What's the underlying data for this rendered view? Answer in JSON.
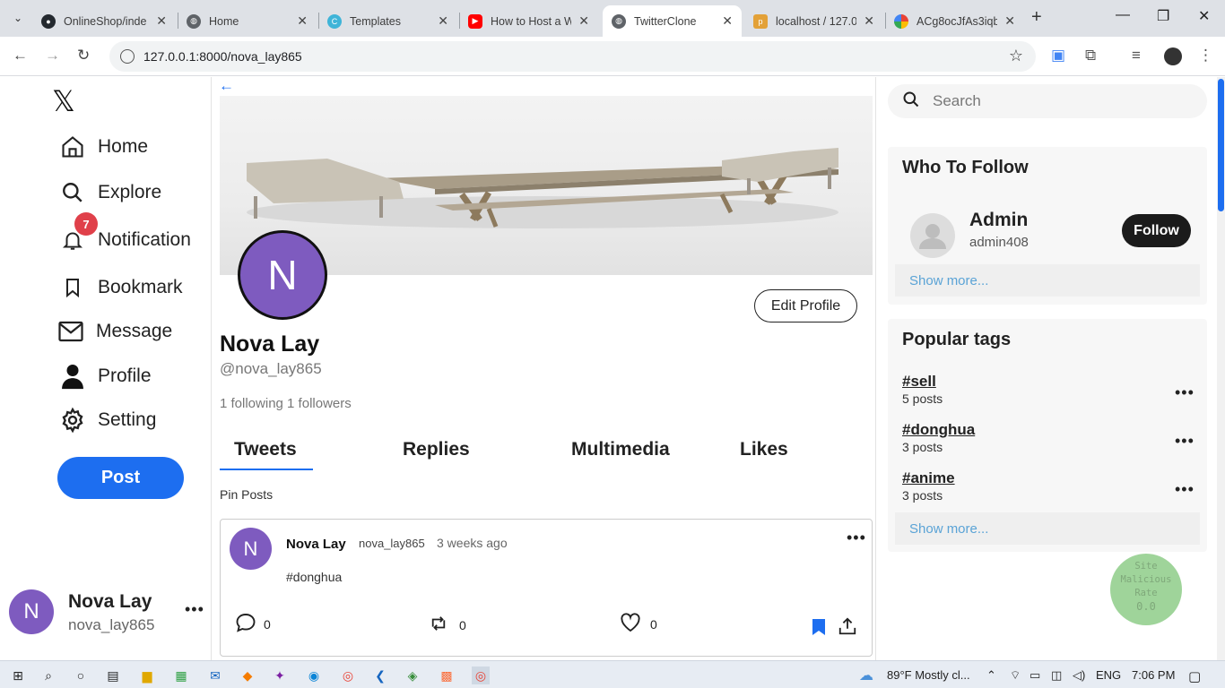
{
  "browser": {
    "tabs": [
      {
        "title": "OnlineShop/inde",
        "icon": "github-icon",
        "color": "#24292f"
      },
      {
        "title": "Home",
        "icon": "globe-icon",
        "color": "#5f6368"
      },
      {
        "title": "Templates",
        "icon": "canva-icon",
        "color": "#3fb4d8"
      },
      {
        "title": "How to Host a W",
        "icon": "youtube-icon",
        "color": "#ff0000"
      },
      {
        "title": "TwitterClone",
        "icon": "globe-icon",
        "color": "#5f6368"
      },
      {
        "title": "localhost / 127.0",
        "icon": "phpmyadmin-icon",
        "color": "#e3a138"
      },
      {
        "title": "ACg8ocJfAs3iqb",
        "icon": "google-photos-icon",
        "color": "#ea4335"
      }
    ],
    "url": "127.0.0.1:8000/nova_lay865"
  },
  "sidebar": {
    "logo": "𝕏",
    "items": [
      {
        "label": "Home",
        "icon": "home-icon"
      },
      {
        "label": "Explore",
        "icon": "search-icon"
      },
      {
        "label": "Notification",
        "icon": "bell-icon"
      },
      {
        "label": "Bookmark",
        "icon": "bookmark-icon"
      },
      {
        "label": "Message",
        "icon": "mail-icon"
      },
      {
        "label": "Profile",
        "icon": "user-icon"
      },
      {
        "label": "Setting",
        "icon": "gear-icon"
      }
    ],
    "notification_count": "7",
    "post_label": "Post",
    "account": {
      "initial": "N",
      "name": "Nova Lay",
      "handle": "nova_lay865",
      "more": "•••"
    }
  },
  "profile": {
    "back": "←",
    "initial": "N",
    "edit_label": "Edit Profile",
    "name": "Nova Lay",
    "handle": "@nova_lay865",
    "follow_stats": "1 following 1 followers",
    "tabs": [
      "Tweets",
      "Replies",
      "Multimedia",
      "Likes"
    ],
    "pin_label": "Pin Posts"
  },
  "tweet": {
    "initial": "N",
    "name": "Nova Lay",
    "handle": "nova_lay865",
    "time": "3 weeks ago",
    "more": "•••",
    "body": "#donghua",
    "comments": "0",
    "retweets": "0",
    "likes": "0"
  },
  "right": {
    "search_placeholder": "Search",
    "who_to_follow": {
      "title": "Who To Follow",
      "user": {
        "name": "Admin",
        "handle": "admin408"
      },
      "follow_label": "Follow",
      "show_more": "Show more..."
    },
    "popular_tags": {
      "title": "Popular tags",
      "tags": [
        {
          "name": "#sell",
          "count": "5 posts"
        },
        {
          "name": "#donghua",
          "count": "3 posts"
        },
        {
          "name": "#anime",
          "count": "3 posts"
        }
      ],
      "more": "•••",
      "show_more": "Show more..."
    }
  },
  "malicious": {
    "line1": "Site",
    "line2": "Malicious",
    "line3": "Rate",
    "value": "0.0"
  },
  "taskbar": {
    "weather": "89°F  Mostly cl...",
    "lang": "ENG",
    "time": "7:06 PM"
  },
  "colors": {
    "accent": "#1d6ef0",
    "avatar": "#7e5bbf",
    "badge": "#e0404a"
  }
}
